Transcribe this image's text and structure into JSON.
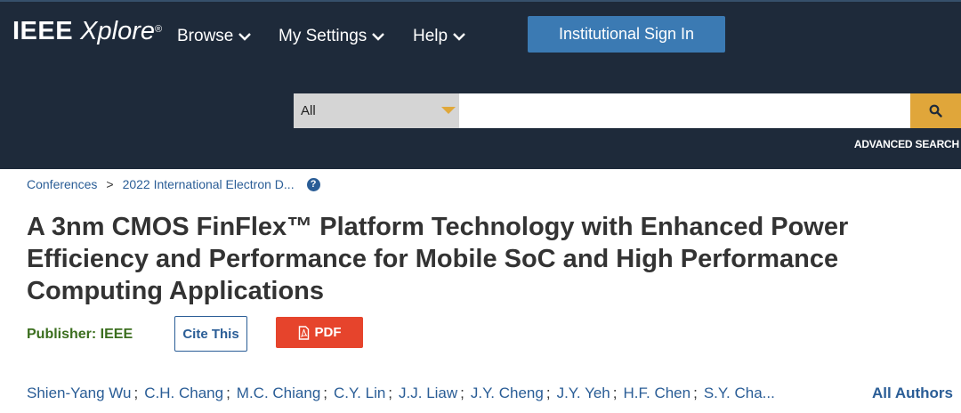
{
  "header": {
    "logo_main": "IEEE",
    "logo_sub": "Xplore",
    "logo_reg": "®",
    "nav": [
      {
        "label": "Browse"
      },
      {
        "label": "My Settings"
      },
      {
        "label": "Help"
      }
    ],
    "signin_label": "Institutional Sign In",
    "search": {
      "scope": "All",
      "query": "",
      "placeholder": "",
      "button_icon": "search-icon"
    },
    "advanced_search_label": "ADVANCED SEARCH"
  },
  "breadcrumb": {
    "items": [
      "Conferences",
      "2022 International Electron D..."
    ],
    "separator": ">",
    "help_icon": "help-circle-icon",
    "help_glyph": "?"
  },
  "article": {
    "title": "A 3nm CMOS FinFlex™ Platform Technology with Enhanced Power Efficiency and Performance for Mobile SoC and High Performance Computing Applications",
    "publisher_label": "Publisher: IEEE",
    "cite_label": "Cite This",
    "pdf_label": "PDF",
    "pdf_icon": "pdf-file-icon",
    "authors": [
      "Shien-Yang Wu",
      "C.H. Chang",
      "M.C. Chiang",
      "C.Y. Lin",
      "J.J. Liaw",
      "J.Y. Cheng",
      "J.Y. Yeh",
      "H.F. Chen",
      "S.Y. Cha..."
    ],
    "author_separator": ";",
    "all_authors_label": "All Authors"
  },
  "colors": {
    "header_bg": "#1e2a3a",
    "signin_bg": "#3b7ab3",
    "search_btn": "#e0a63a",
    "link": "#2a5d96",
    "pdf_bg": "#e6442c",
    "publisher": "#3b6e1e"
  }
}
